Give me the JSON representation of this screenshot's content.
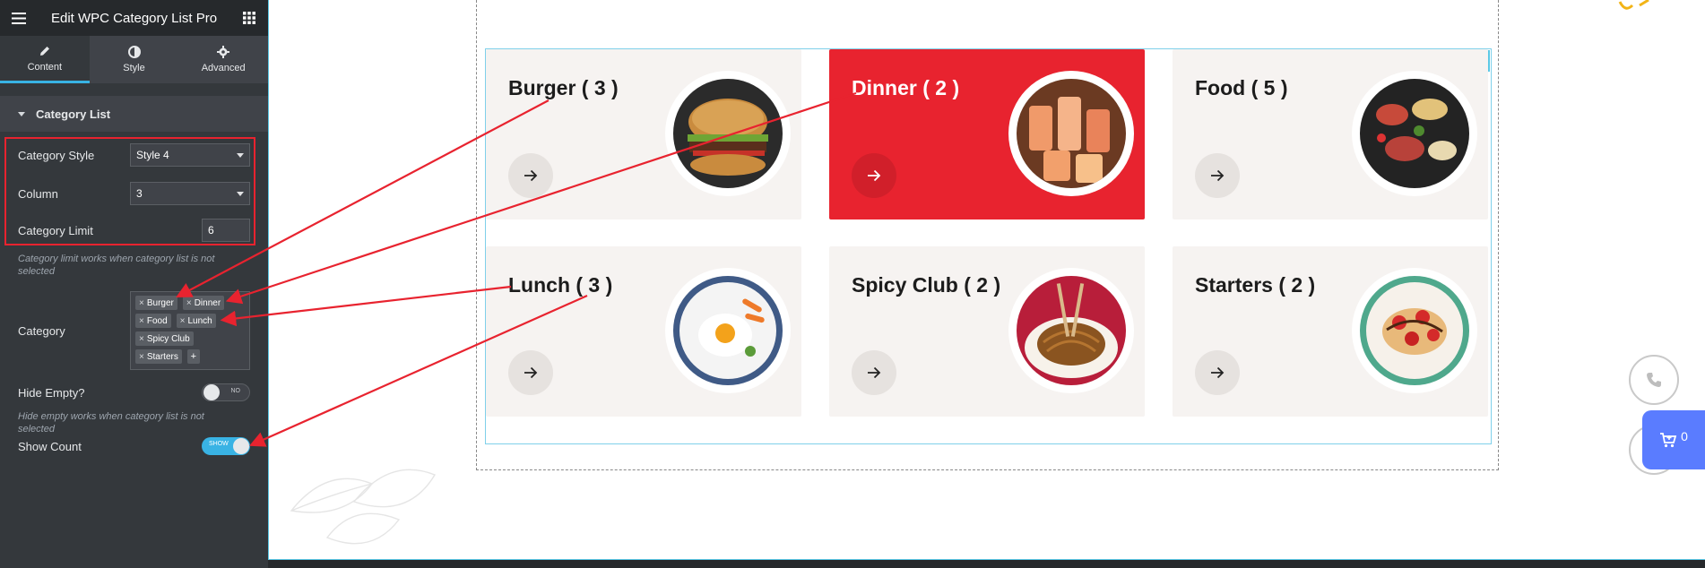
{
  "editor": {
    "title": "Edit WPC Category List Pro",
    "tabs": [
      {
        "label": "Content",
        "icon": "pencil-icon",
        "active": true
      },
      {
        "label": "Style",
        "icon": "half-circle-icon",
        "active": false
      },
      {
        "label": "Advanced",
        "icon": "gear-icon",
        "active": false
      }
    ],
    "section_title": "Category List",
    "controls": {
      "category_style": {
        "label": "Category Style",
        "value": "Style 4"
      },
      "column": {
        "label": "Column",
        "value": "3"
      },
      "category_limit": {
        "label": "Category Limit",
        "value": "6"
      },
      "category_limit_help": "Category limit works when category list is not selected",
      "category": {
        "label": "Category",
        "chips": [
          "Burger",
          "Dinner",
          "Food",
          "Lunch",
          "Spicy Club",
          "Starters"
        ],
        "add": "+"
      },
      "hide_empty": {
        "label": "Hide Empty?",
        "state": "NO"
      },
      "hide_empty_help": "Hide empty works when category list is not selected",
      "show_count": {
        "label": "Show Count",
        "state": "SHOW"
      }
    }
  },
  "preview": {
    "cards": [
      {
        "title": "Burger ( 3 )",
        "active": false,
        "image": "burger-photo"
      },
      {
        "title": "Dinner ( 2 )",
        "active": true,
        "image": "cocktails-photo"
      },
      {
        "title": "Food ( 5 )",
        "active": false,
        "image": "platter-photo"
      },
      {
        "title": "Lunch ( 3 )",
        "active": false,
        "image": "fried-egg-photo"
      },
      {
        "title": "Spicy Club ( 2 )",
        "active": false,
        "image": "noodles-photo"
      },
      {
        "title": "Starters ( 2 )",
        "active": false,
        "image": "crepe-photo"
      }
    ],
    "cart_count": "0"
  },
  "colors": {
    "panel_bg": "#34383c",
    "accent": "#39b3e4",
    "active_card": "#e8232f",
    "annotation": "#e8232f",
    "cart": "#5a7cff"
  }
}
